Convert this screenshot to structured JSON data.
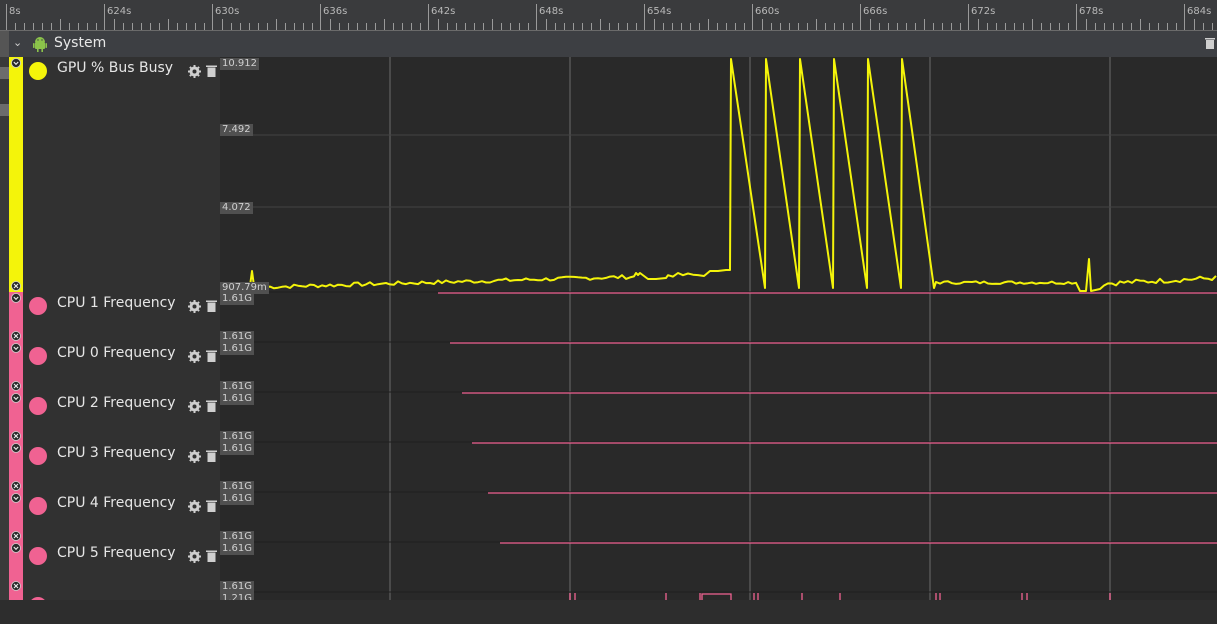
{
  "timeline": {
    "ticks": [
      {
        "label": "8s"
      },
      {
        "label": "624s"
      },
      {
        "label": "630s"
      },
      {
        "label": "636s"
      },
      {
        "label": "642s"
      },
      {
        "label": "648s"
      },
      {
        "label": "654s"
      },
      {
        "label": "660s"
      },
      {
        "label": "666s"
      },
      {
        "label": "672s"
      },
      {
        "label": "678s"
      },
      {
        "label": "684s"
      }
    ]
  },
  "group": {
    "title": "System",
    "icon": "android-icon"
  },
  "tracks": [
    {
      "name": "GPU % Bus Busy",
      "color": "#f4f40a",
      "y_labels": [
        "10.912",
        "7.492",
        "4.072",
        "907.79m"
      ]
    },
    {
      "name": "CPU 1 Frequency",
      "color": "#f06292",
      "y_labels": [
        "1.61G",
        "1.61G"
      ]
    },
    {
      "name": "CPU 0 Frequency",
      "color": "#f06292",
      "y_labels": [
        "1.61G",
        "1.61G"
      ]
    },
    {
      "name": "CPU 2 Frequency",
      "color": "#f06292",
      "y_labels": [
        "1.61G",
        "1.61G"
      ]
    },
    {
      "name": "CPU 3 Frequency",
      "color": "#f06292",
      "y_labels": [
        "1.61G",
        "1.61G"
      ]
    },
    {
      "name": "CPU 4 Frequency",
      "color": "#f06292",
      "y_labels": [
        "1.61G",
        "1.61G"
      ]
    },
    {
      "name": "CPU 5 Frequency",
      "color": "#f06292",
      "y_labels": [
        "1.61G",
        "1.61G"
      ]
    },
    {
      "name": "",
      "color": "#f06292",
      "y_labels": [
        "1.21G"
      ]
    }
  ],
  "colors": {
    "accent_yellow": "#f4f40a",
    "accent_pink": "#f06292",
    "track_bg": "#313131",
    "plot_bg": "#292929"
  }
}
